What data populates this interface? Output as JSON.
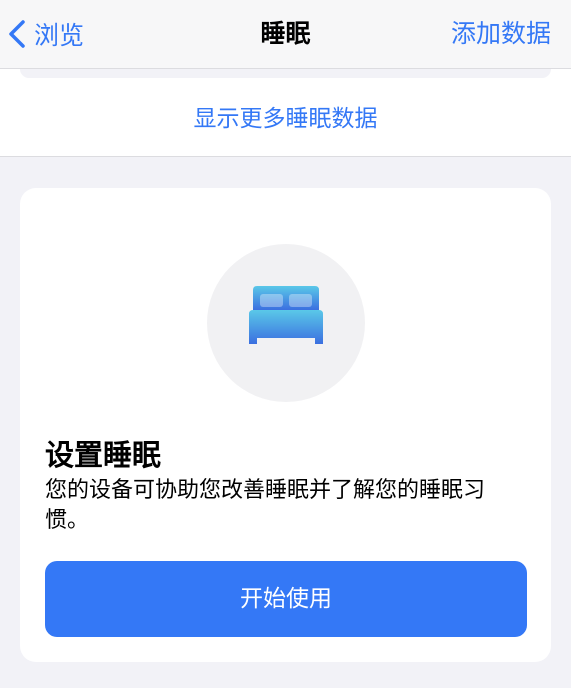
{
  "nav": {
    "back_label": "浏览",
    "title": "睡眠",
    "add_data_label": "添加数据"
  },
  "more_data_link": "显示更多睡眠数据",
  "setup_card": {
    "icon": "bed-icon",
    "title": "设置睡眠",
    "description": "您的设备可协助您改善睡眠并了解您的睡眠习惯。",
    "start_button_label": "开始使用"
  },
  "colors": {
    "accent": "#3478f6",
    "background": "#f2f2f7",
    "icon_gradient_top": "#5ac8e8",
    "icon_gradient_bottom": "#3b6fe0"
  }
}
